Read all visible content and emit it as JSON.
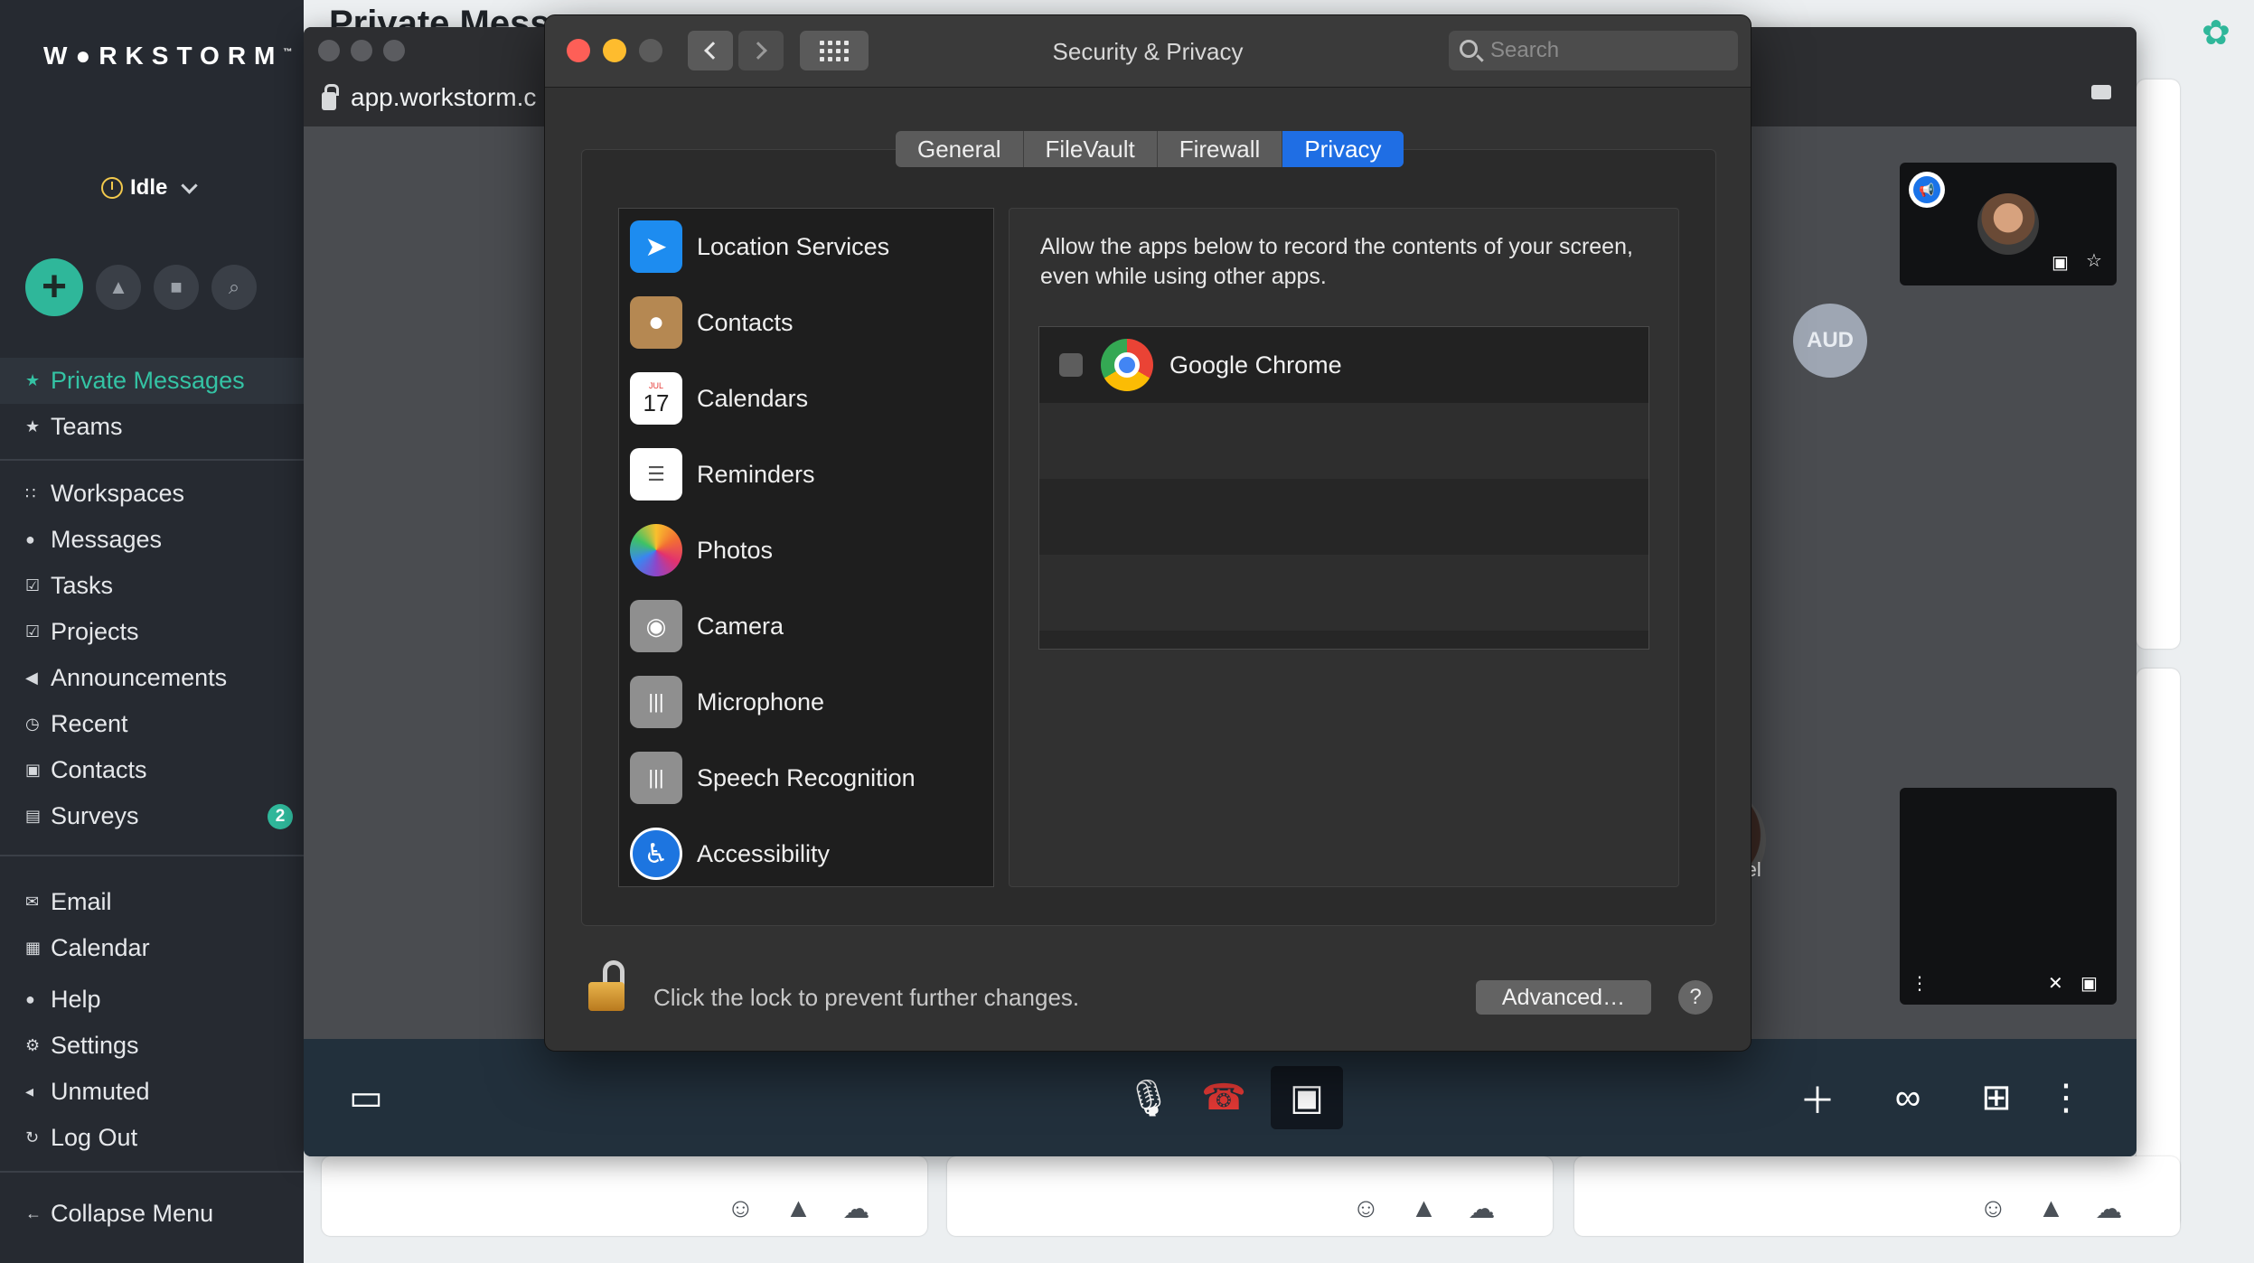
{
  "workstorm": {
    "logo": "W●RKSTORM",
    "trademark": "™",
    "status": "Idle",
    "nav_primary": [
      {
        "label": "Private Messages",
        "icon": "★",
        "active": true
      },
      {
        "label": "Teams",
        "icon": "★"
      }
    ],
    "nav_main": [
      {
        "label": "Workspaces",
        "icon": "∷"
      },
      {
        "label": "Messages",
        "icon": "●"
      },
      {
        "label": "Tasks",
        "icon": "☑"
      },
      {
        "label": "Projects",
        "icon": "☑"
      },
      {
        "label": "Announcements",
        "icon": "◀"
      },
      {
        "label": "Recent",
        "icon": "◷"
      },
      {
        "label": "Contacts",
        "icon": "▣"
      },
      {
        "label": "Surveys",
        "icon": "▤",
        "badge": "2"
      }
    ],
    "nav_secondary": [
      {
        "label": "Email",
        "icon": "✉"
      },
      {
        "label": "Calendar",
        "icon": "▦"
      },
      {
        "label": "Help",
        "icon": "●"
      },
      {
        "label": "Settings",
        "icon": "⚙"
      },
      {
        "label": "Unmuted",
        "icon": "◂"
      },
      {
        "label": "Log Out",
        "icon": "↻"
      }
    ],
    "collapse": "Collapse Menu",
    "bg_title": "Private Messa"
  },
  "chrome": {
    "url": "app.workstorm.c"
  },
  "meeting": {
    "aud_label": "AUD",
    "participant_name": "Sneh Patel"
  },
  "prefs": {
    "title": "Security & Privacy",
    "search_placeholder": "Search",
    "tabs": [
      "General",
      "FileVault",
      "Firewall",
      "Privacy"
    ],
    "selected_tab": "Privacy",
    "categories": [
      {
        "label": "Location Services",
        "icon": "location-services-icon",
        "color": "#1d8cf0"
      },
      {
        "label": "Contacts",
        "icon": "contacts-icon",
        "color": "#b58852"
      },
      {
        "label": "Calendars",
        "icon": "calendar-icon",
        "color": "#ffffff"
      },
      {
        "label": "Reminders",
        "icon": "reminders-icon",
        "color": "#ffffff"
      },
      {
        "label": "Photos",
        "icon": "photos-icon",
        "color": "#ffffff"
      },
      {
        "label": "Camera",
        "icon": "camera-icon",
        "color": "#8f8f8f"
      },
      {
        "label": "Microphone",
        "icon": "microphone-icon",
        "color": "#8f8f8f"
      },
      {
        "label": "Speech Recognition",
        "icon": "speech-recognition-icon",
        "color": "#8f8f8f"
      },
      {
        "label": "Accessibility",
        "icon": "accessibility-icon",
        "color": "#1d75e0"
      }
    ],
    "calendar_day": "17",
    "calendar_month": "JUL",
    "description": "Allow the apps below to record the contents of your screen, even while using other apps.",
    "apps": [
      {
        "name": "Google Chrome",
        "checked": false
      }
    ],
    "lock_text": "Click the lock to prevent further changes.",
    "advanced_label": "Advanced…",
    "help_label": "?"
  },
  "colors": {
    "accent": "#2fb79a",
    "mac_selected": "#1f6ee4",
    "close": "#fe5f57",
    "minimize": "#febc2e"
  }
}
